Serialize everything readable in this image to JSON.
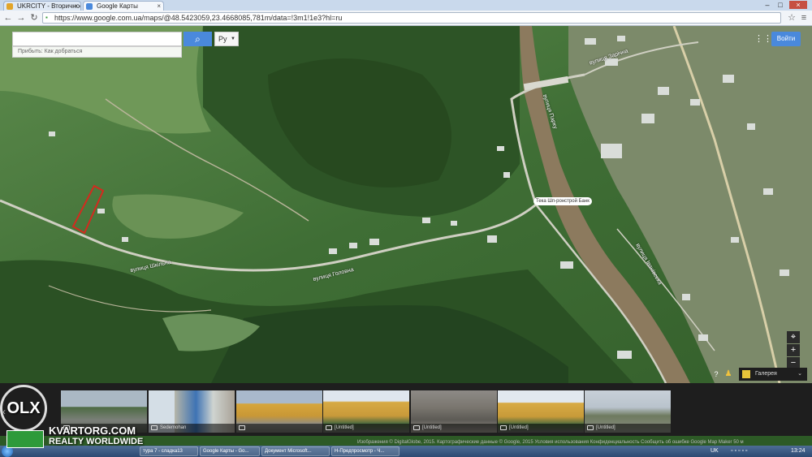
{
  "browser": {
    "tabs": [
      {
        "label": "UKRCITY - Вторичное жилье",
        "active": false
      },
      {
        "label": "Google Карты",
        "active": true
      }
    ],
    "url": "https://www.google.com.ua/maps/@48.5423059,23.4668085,781m/data=!3m1!1e3?hl=ru"
  },
  "map": {
    "search": {
      "value": "",
      "placeholder": "",
      "hint": "Прибыть: Как добраться",
      "lang": "Ру"
    },
    "signin_label": "Войти",
    "zoom_in": "+",
    "zoom_out": "−",
    "poi": [
      "Тека Шп-ронстрой Банк"
    ],
    "streets": [
      "вулиця Шкільна",
      "вулиця Головна",
      "вулиця Парку",
      "вулиця Іванівська",
      "вулиця Зарічна"
    ],
    "gallery_label": "Галерея",
    "colors": {
      "satellite_base": "#3c6e33",
      "river": "#8c7a5e",
      "parcel_outline": "#d42a1e",
      "accent": "#4a89dc"
    }
  },
  "photos": [
    {
      "caption": ""
    },
    {
      "caption": "Sedemohan"
    },
    {
      "caption": ""
    },
    {
      "caption": "[Untitled]"
    },
    {
      "caption": "[Untitled]"
    },
    {
      "caption": "[Untitled]"
    },
    {
      "caption": "[Untitled]"
    }
  ],
  "footer": "Изображения © DigitalGlobe, 2015. Картографические данные © Google, 2015   Условия использования   Конфиденциальность   Сообщить об ошибке   Google Map Maker   50 м",
  "taskbar": {
    "items": [
      "тура 7 - сладка13",
      "Google Карты - Go...",
      "Документ Microsoft...",
      "Н-Предпросмотр - Ч..."
    ],
    "lang": "UK",
    "time": "13:24"
  },
  "watermark": {
    "line1": "KVARTORG.COM",
    "line2": "REALTY WORLDWIDE",
    "logo_text": "OLX"
  }
}
